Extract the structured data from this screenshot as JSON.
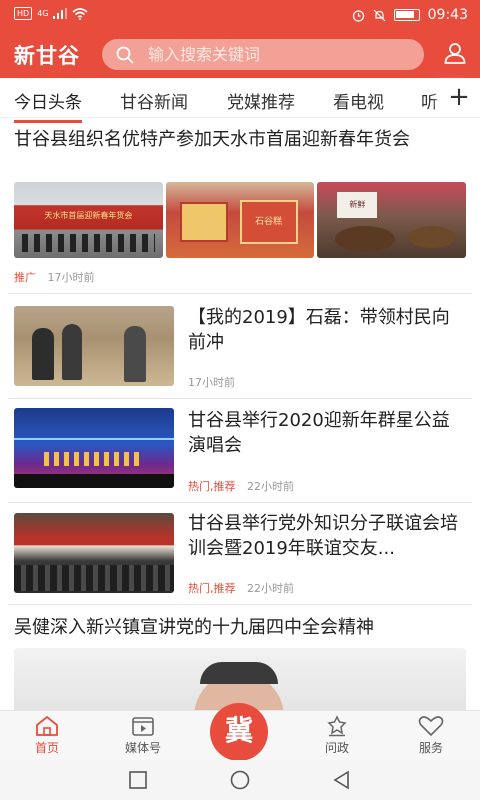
{
  "status": {
    "signal_text": "HD",
    "network": "4G",
    "time": "09:43"
  },
  "header": {
    "logo": "新甘谷",
    "search_placeholder": "输入搜索关键词"
  },
  "tabs": [
    "今日头条",
    "甘谷新闻",
    "党媒推荐",
    "看电视",
    "听"
  ],
  "articles": {
    "a1": {
      "title": "甘谷县组织名优特产参加天水市首届迎新春年货会",
      "tag": "推广",
      "time": "17小时前",
      "image_captions": [
        "天水市首届迎新春年货会",
        "石谷糕",
        "新鲜"
      ]
    },
    "a2": {
      "title": "【我的2019】石磊：带领村民向前冲",
      "time": "17小时前"
    },
    "a3": {
      "title": "甘谷县举行2020迎新年群星公益演唱会",
      "tag": "热门,推荐",
      "time": "22小时前"
    },
    "a4": {
      "title": "甘谷县举行党外知识分子联谊会培训会暨2019年联谊交友...",
      "tag": "热门,推荐",
      "time": "22小时前"
    },
    "a5": {
      "title": "吴健深入新兴镇宣讲党的十九届四中全会精神"
    }
  },
  "bottom_nav": {
    "home": "首页",
    "media": "媒体号",
    "center": "冀",
    "politics": "问政",
    "service": "服务"
  },
  "colors": {
    "accent": "#e84c3d"
  }
}
